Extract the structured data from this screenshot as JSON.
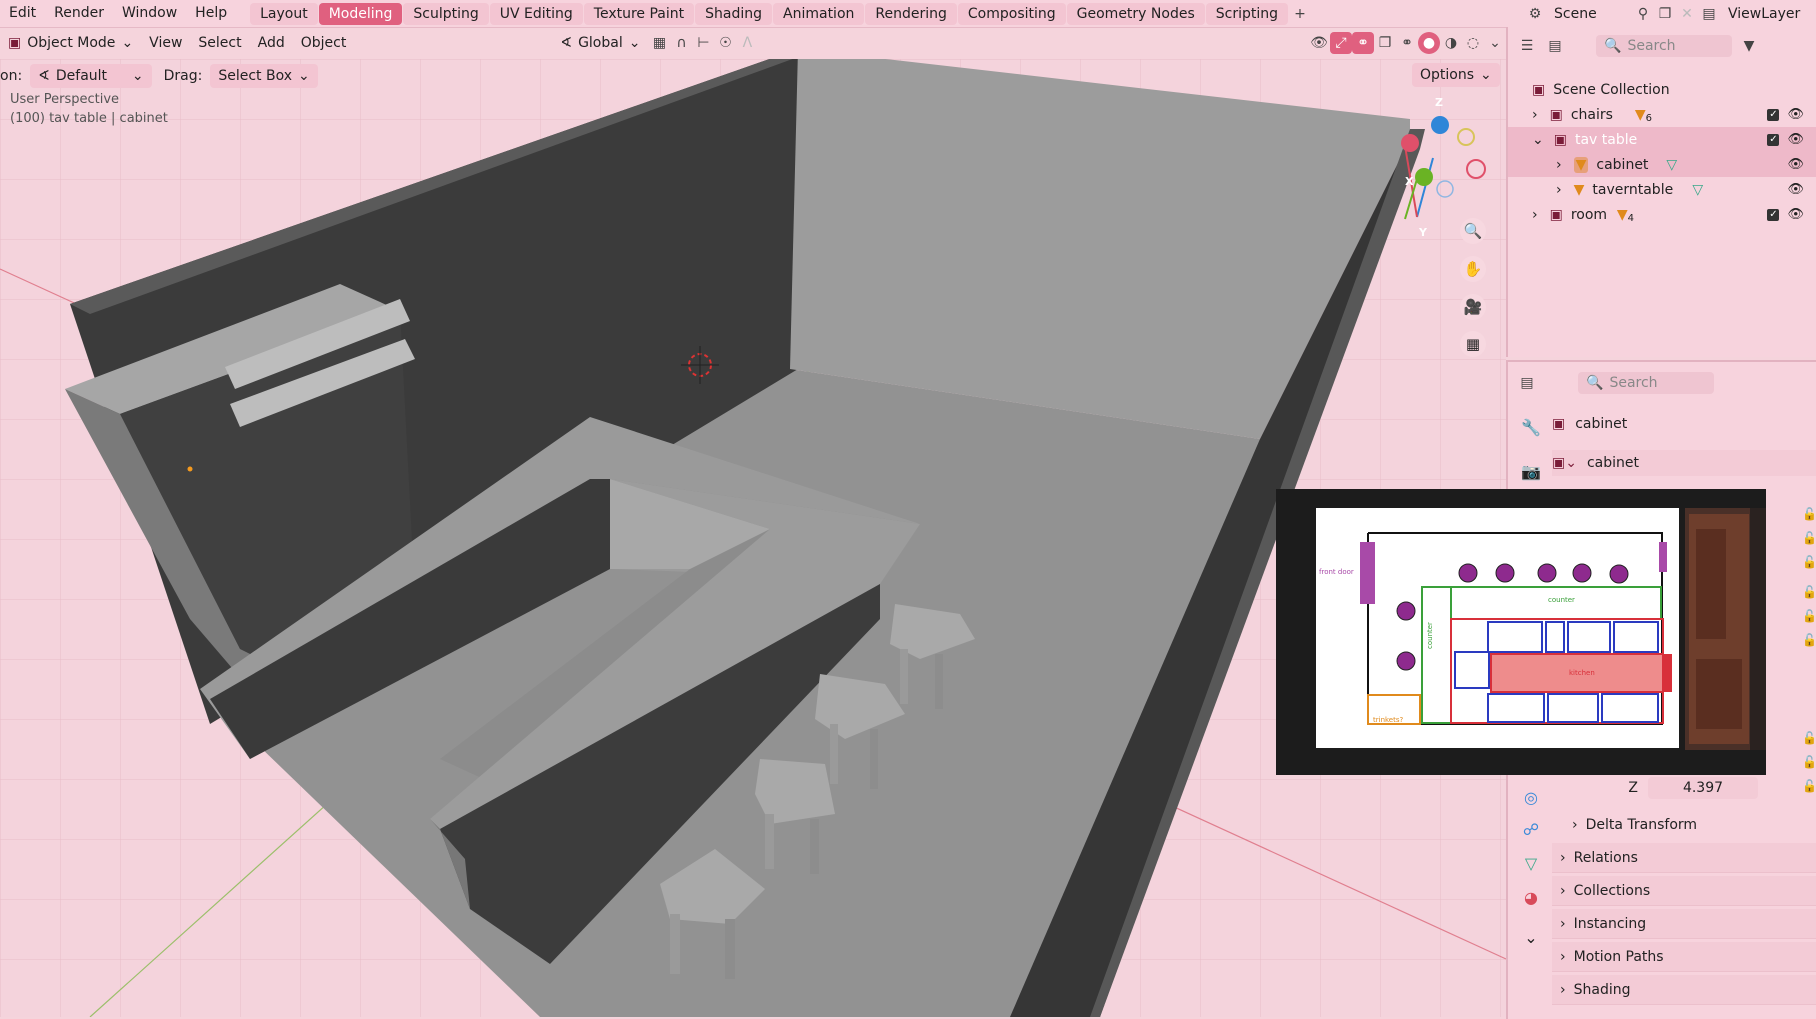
{
  "menubar": {
    "items": [
      "Edit",
      "Render",
      "Window",
      "Help"
    ],
    "workspaces": [
      "Layout",
      "Modeling",
      "Sculpting",
      "UV Editing",
      "Texture Paint",
      "Shading",
      "Animation",
      "Rendering",
      "Compositing",
      "Geometry Nodes",
      "Scripting"
    ],
    "active_workspace": "Modeling",
    "add_tab": "+",
    "scene_label": "Scene",
    "view_layer_label": "ViewLayer"
  },
  "header": {
    "mode": "Object Mode",
    "menus": [
      "View",
      "Select",
      "Add",
      "Object"
    ],
    "orientation": "Global",
    "orientation_label": "on:",
    "orientation_value": "Default",
    "drag_label": "Drag:",
    "drag_value": "Select Box",
    "options_label": "Options"
  },
  "viewport": {
    "perspective": "User Perspective",
    "context": "(100) tav table | cabinet",
    "gizmo": {
      "x": "X",
      "y": "Y",
      "z": "Z"
    }
  },
  "outliner": {
    "search_placeholder": "Search",
    "root": "Scene Collection",
    "items": [
      {
        "label": "chairs",
        "count": "6"
      },
      {
        "label": "tav table"
      },
      {
        "label": "cabinet"
      },
      {
        "label": "taverntable"
      },
      {
        "label": "room",
        "count": "4"
      }
    ]
  },
  "properties": {
    "search_placeholder": "Search",
    "object_name": "cabinet",
    "data_name": "cabinet",
    "z_label": "Z",
    "z_value": "4.397",
    "sections": [
      "Delta Transform",
      "Relations",
      "Collections",
      "Instancing",
      "Motion Paths",
      "Shading"
    ]
  },
  "reference_image": {
    "labels": {
      "front_door": "front door",
      "counter_top": "counter",
      "counter_side": "counter",
      "kitchen": "kitchen",
      "trinkets": "trinkets?"
    }
  },
  "colors": {
    "accent": "#e0607f",
    "header_bg": "#f7d3dd",
    "viewport_bg": "#f4d3dc",
    "wall_dark": "#3a3a3a",
    "surface_gray": "#8c8c8c"
  }
}
